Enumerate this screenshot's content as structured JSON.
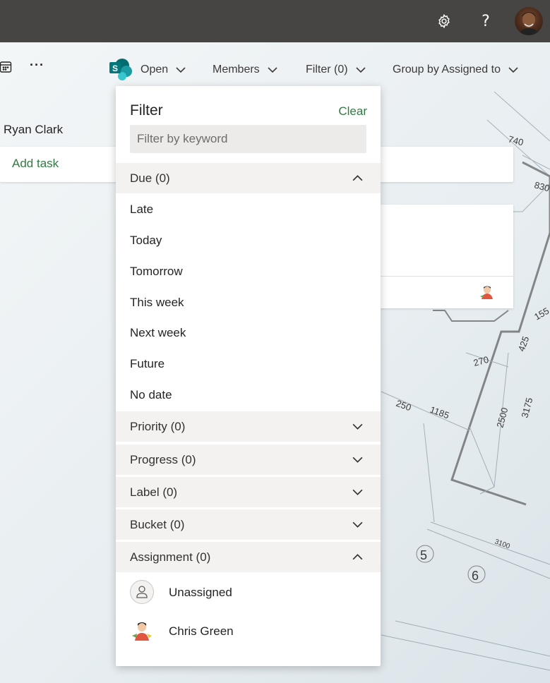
{
  "topbar": {
    "settings_icon": "gear-icon",
    "help_label": "?",
    "avatar_icon": "user-avatar"
  },
  "commandbar": {
    "more_label": "···",
    "open_label": "Open",
    "members_label": "Members",
    "filter_label": "Filter (0)",
    "group_label": "Group by Assigned to"
  },
  "board": {
    "column_name": "Ryan Clark",
    "add_task_label": "Add task"
  },
  "filter_panel": {
    "title": "Filter",
    "clear_label": "Clear",
    "search_placeholder": "Filter by keyword",
    "due": {
      "label": "Due (0)",
      "options": [
        "Late",
        "Today",
        "Tomorrow",
        "This week",
        "Next week",
        "Future",
        "No date"
      ]
    },
    "priority_label": "Priority (0)",
    "progress_label": "Progress (0)",
    "label_label": "Label (0)",
    "bucket_label": "Bucket (0)",
    "assignment": {
      "label": "Assignment (0)",
      "people": [
        "Unassigned",
        "Chris Green"
      ]
    }
  },
  "colors": {
    "topbar": "#464544",
    "accent_green": "#327a43",
    "section_bg": "#f3f2f1"
  }
}
